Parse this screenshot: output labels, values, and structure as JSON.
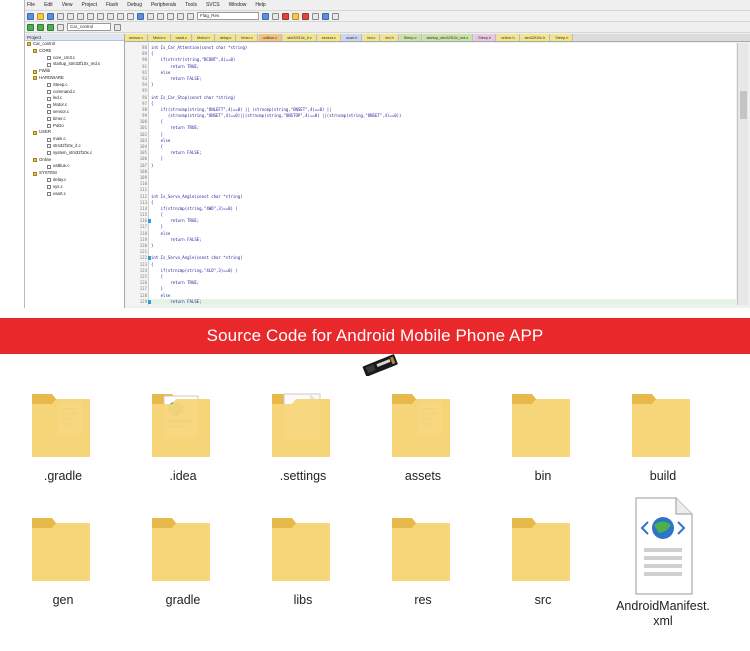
{
  "ide": {
    "menu": [
      "File",
      "Edit",
      "View",
      "Project",
      "Flash",
      "Debug",
      "Peripherals",
      "Tools",
      "SVCS",
      "Window",
      "Help"
    ],
    "target_combo": "Flag_Res",
    "project_combo": "Car_control",
    "project_panel_title": "Project",
    "tree": [
      {
        "label": "Car_control",
        "type": "folder"
      },
      {
        "label": "CORE",
        "type": "folder"
      },
      {
        "label": "core_cm3.c",
        "type": "file"
      },
      {
        "label": "startup_stm32f10x_md.s",
        "type": "file"
      },
      {
        "label": "FWlib",
        "type": "folder"
      },
      {
        "label": "HARDWARE",
        "type": "folder"
      },
      {
        "label": "Steep.c",
        "type": "file"
      },
      {
        "label": "command.c",
        "type": "file"
      },
      {
        "label": "led.c",
        "type": "file"
      },
      {
        "label": "Motor.c",
        "type": "file"
      },
      {
        "label": "sensor.c",
        "type": "file"
      },
      {
        "label": "timer.c",
        "type": "file"
      },
      {
        "label": "PoDo",
        "type": "file"
      },
      {
        "label": "USER",
        "type": "folder"
      },
      {
        "label": "main.c",
        "type": "file"
      },
      {
        "label": "stm32f10x_it.c",
        "type": "file"
      },
      {
        "label": "system_stm32f10x.c",
        "type": "file"
      },
      {
        "label": "Online",
        "type": "folder"
      },
      {
        "label": "usBlue.c",
        "type": "file"
      },
      {
        "label": "SYSTEM",
        "type": "folder"
      },
      {
        "label": "delay.c",
        "type": "file"
      },
      {
        "label": "sys.c",
        "type": "file"
      },
      {
        "label": "usart.c",
        "type": "file"
      }
    ],
    "tabs": [
      {
        "label": "sensor.c",
        "color": "y"
      },
      {
        "label": "Motor.c",
        "color": "y"
      },
      {
        "label": "usart.c",
        "color": "y"
      },
      {
        "label": "Motor.h",
        "color": "y"
      },
      {
        "label": "delay.c",
        "color": "y"
      },
      {
        "label": "timer.c",
        "color": "y"
      },
      {
        "label": "usBlue.c",
        "color": "o"
      },
      {
        "label": "stm32f10x_it.c",
        "color": "y"
      },
      {
        "label": "sensor.c",
        "color": "y"
      },
      {
        "label": "usart.h",
        "color": "b"
      },
      {
        "label": "led.c",
        "color": "y"
      },
      {
        "label": "led.h",
        "color": "y"
      },
      {
        "label": "Steep.c",
        "color": "g"
      },
      {
        "label": "startup_stm32f10x_md.s",
        "color": "g"
      },
      {
        "label": "Steep.h",
        "color": "p"
      },
      {
        "label": "online.h",
        "color": "y"
      },
      {
        "label": "stm32f10x.h",
        "color": "y"
      },
      {
        "label": "Steep.h",
        "color": "y"
      }
    ],
    "code": [
      {
        "n": "88",
        "t": "int Is_Car_Attention(const char *string)"
      },
      {
        "n": "89",
        "t": "{"
      },
      {
        "n": "90",
        "t": "    if(strstr(string,\"BCONT\",4)==0)"
      },
      {
        "n": "91",
        "t": "        return TRUE;"
      },
      {
        "n": "92",
        "t": "    else"
      },
      {
        "n": "93",
        "t": "        return FALSE;"
      },
      {
        "n": "94",
        "t": "}"
      },
      {
        "n": "95",
        "t": ""
      },
      {
        "n": "96",
        "t": "int Is_Car_Stop(const char *string)"
      },
      {
        "n": "97",
        "t": "{"
      },
      {
        "n": "98",
        "t": "    if((strncmp(string,\"ONLEFT\",4)==0) || (strncmp(string,\"ONSET\",4)==0) ||"
      },
      {
        "n": "99",
        "t": "       (strncmp(string,\"ONSET\",4)==0)||(strncmp(string,\"ONSTOP\",4)==0) ||(strncmp(string,\"ONSET\",4)==0))"
      },
      {
        "n": "100",
        "t": "    {"
      },
      {
        "n": "101",
        "t": "        return TRUE;"
      },
      {
        "n": "102",
        "t": "    }"
      },
      {
        "n": "103",
        "t": "    else"
      },
      {
        "n": "104",
        "t": "    {"
      },
      {
        "n": "105",
        "t": "        return FALSE;"
      },
      {
        "n": "106",
        "t": "    }"
      },
      {
        "n": "107",
        "t": "}"
      },
      {
        "n": "108",
        "t": ""
      },
      {
        "n": "109",
        "t": ""
      },
      {
        "n": "110",
        "t": ""
      },
      {
        "n": "111",
        "t": ""
      },
      {
        "n": "112",
        "t": "int Is_Servo_Angle(const char *string)"
      },
      {
        "n": "113",
        "t": "{"
      },
      {
        "n": "114",
        "t": "    if(strncmp(string,\"4WD\",3)==0) )"
      },
      {
        "n": "115",
        "t": "    {"
      },
      {
        "n": "116",
        "t": "        return TRUE;"
      },
      {
        "n": "117",
        "t": "    }"
      },
      {
        "n": "118",
        "t": "    else"
      },
      {
        "n": "119",
        "t": "        return FALSE;"
      },
      {
        "n": "120",
        "t": "}"
      },
      {
        "n": "121",
        "t": ""
      },
      {
        "n": "122",
        "t": "int Is_Servo_Angle(const char *string)"
      },
      {
        "n": "123",
        "t": "{"
      },
      {
        "n": "124",
        "t": "    if(strncmp(string,\"4LD\",3)==0) )"
      },
      {
        "n": "125",
        "t": "    {"
      },
      {
        "n": "126",
        "t": "        return TRUE;"
      },
      {
        "n": "127",
        "t": "    }"
      },
      {
        "n": "128",
        "t": "    else"
      },
      {
        "n": "129",
        "t": "        return FALSE;"
      }
    ]
  },
  "banner": {
    "title": "Source Code for Android Mobile Phone APP"
  },
  "files": [
    {
      "label": ".gradle",
      "kind": "folder-docs"
    },
    {
      "label": ".idea",
      "kind": "folder-web"
    },
    {
      "label": ".settings",
      "kind": "folder-paper"
    },
    {
      "label": "assets",
      "kind": "folder-docs"
    },
    {
      "label": "bin",
      "kind": "folder"
    },
    {
      "label": "build",
      "kind": "folder"
    },
    {
      "label": "gen",
      "kind": "folder"
    },
    {
      "label": "gradle",
      "kind": "folder"
    },
    {
      "label": "libs",
      "kind": "folder"
    },
    {
      "label": "res",
      "kind": "folder"
    },
    {
      "label": "src",
      "kind": "folder"
    },
    {
      "label": "AndroidManifest.xml",
      "kind": "xml-file"
    }
  ],
  "colors": {
    "banner": "#e8282a",
    "folder": "#f7d67a",
    "folder_dark": "#e6b94a"
  }
}
